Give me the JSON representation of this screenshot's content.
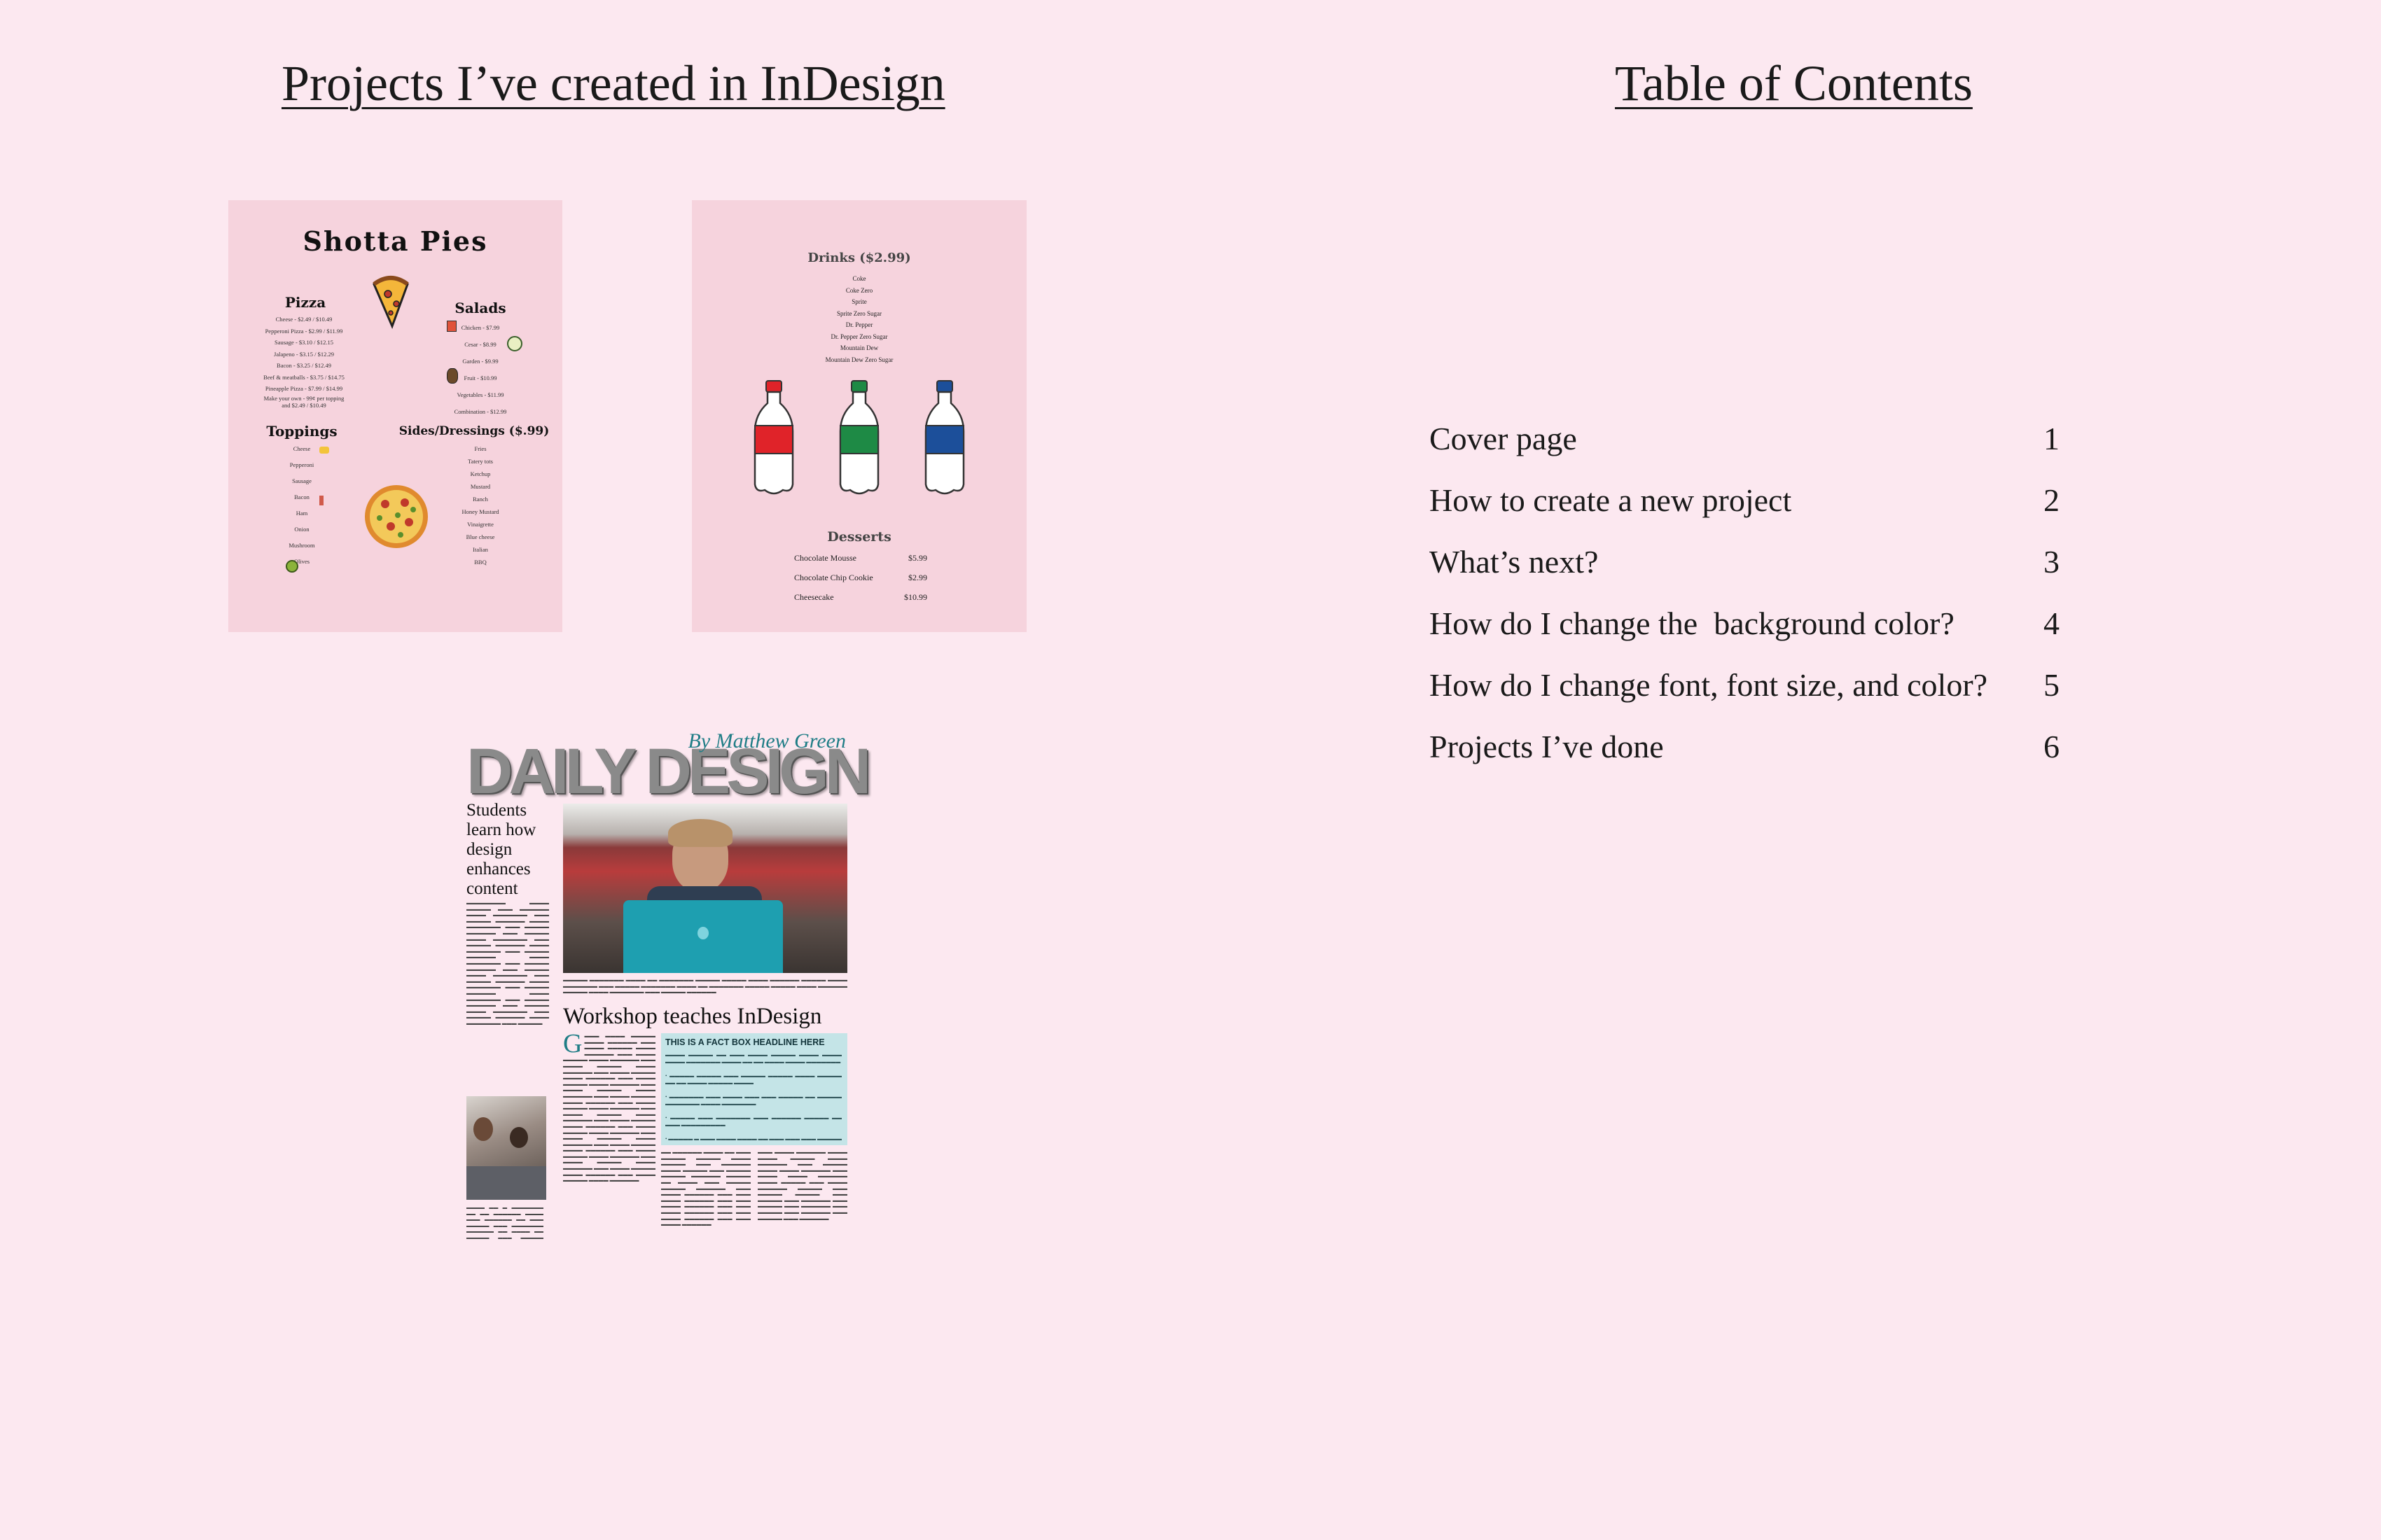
{
  "left_heading": "Projects I’ve created in InDesign",
  "right_heading": "Table of Contents",
  "colors": {
    "background": "#fce8f0",
    "menu_card": "#f6d3dd",
    "accent_teal": "#1f7d86",
    "factbox": "#c4e4e7"
  },
  "pizza_menu": {
    "title": "Shotta Pies",
    "pizza": {
      "title": "Pizza",
      "items": [
        "Cheese - $2.49 / $10.49",
        "Pepperoni Pizza - $2.99 / $11.99",
        "Sausage - $3.10 / $12.15",
        "Jalapeno - $3.15 / $12.29",
        "Bacon - $3.25 / $12.49",
        "Beef & meatballs - $3.75 / $14.75",
        "Pineapple Pizza - $7.99 / $14.99",
        "Make your own - 99¢ per topping",
        "and $2.49 / $10.49"
      ]
    },
    "salads": {
      "title": "Salads",
      "items": [
        "Chicken - $7.99",
        "Cesar - $8.99",
        "Garden - $9.99",
        "Fruit - $10.99",
        "Vegetables - $11.99",
        "Combination - $12.99"
      ]
    },
    "toppings": {
      "title": "Toppings",
      "items": [
        "Cheese",
        "Pepperoni",
        "Sausage",
        "Bacon",
        "Ham",
        "Onion",
        "Mushroom",
        "Olives"
      ]
    },
    "sides": {
      "title": "Sides/Dressings ($.99)",
      "items": [
        "Fries",
        "Tatery tots",
        "Ketchup",
        "Mustard",
        "Ranch",
        "Honey Mustard",
        "Vinaigrette",
        "Blue cheese",
        "Italian",
        "BBQ"
      ]
    }
  },
  "drinks_menu": {
    "drinks_title": "Drinks ($2.99)",
    "drinks": [
      "Coke",
      "Coke Zero",
      "Sprite",
      "Sprite Zero Sugar",
      "Dr. Pepper",
      "Dr. Pepper Zero Sugar",
      "Mountain Dew",
      "Mountain Dew Zero Sugar"
    ],
    "bottle_colors": [
      "#e02329",
      "#1e8a45",
      "#1c4f9a"
    ],
    "desserts_title": "Desserts",
    "desserts": [
      {
        "name": "Chocolate Mousse",
        "price": "$5.99"
      },
      {
        "name": "Chocolate Chip Cookie",
        "price": "$2.99"
      },
      {
        "name": "Cheesecake",
        "price": "$10.99"
      }
    ]
  },
  "newspaper": {
    "byline": "By Matthew Green",
    "masthead": "DAILY DESIGN",
    "headline": "Students learn how design enhances content",
    "story_title": "Workshop teaches InDesign",
    "factbox_title": "THIS IS A FACT BOX HEADLINE HERE"
  },
  "toc": [
    {
      "title": "Cover page",
      "page": "1"
    },
    {
      "title": "How to create a new project",
      "page": "2"
    },
    {
      "title": "What’s next?",
      "page": "3"
    },
    {
      "title": "How do I change the  background color?",
      "page": "4"
    },
    {
      "title": "How do I change font, font size, and color?",
      "page": "5"
    },
    {
      "title": "Projects I’ve done",
      "page": "6"
    }
  ]
}
